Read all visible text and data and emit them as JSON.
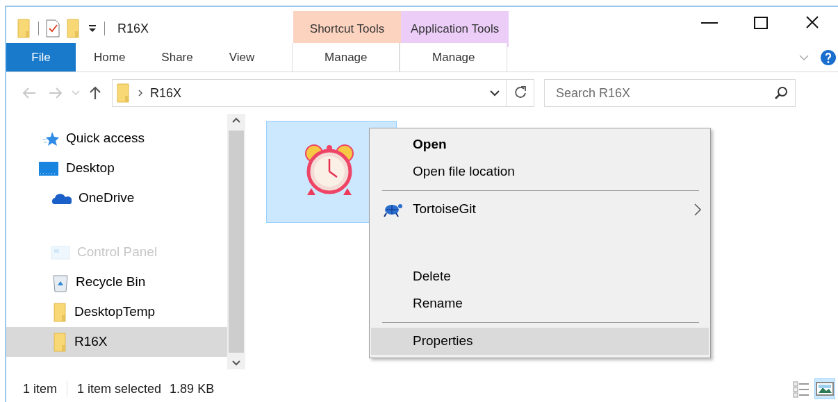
{
  "window": {
    "title": "R16X"
  },
  "context_tabs": [
    {
      "group": "Shortcut Tools",
      "label": "Manage",
      "color": "#fcd3bf"
    },
    {
      "group": "Application Tools",
      "label": "Manage",
      "color": "#ebcdf8"
    }
  ],
  "ribbon_tabs": [
    {
      "label": "File",
      "kind": "file"
    },
    {
      "label": "Home",
      "kind": "tab"
    },
    {
      "label": "Share",
      "kind": "tab"
    },
    {
      "label": "View",
      "kind": "tab"
    }
  ],
  "address": {
    "path": "R16X"
  },
  "search": {
    "placeholder": "Search R16X"
  },
  "sidebar": {
    "items": [
      {
        "label": "Quick access",
        "kind": "star",
        "selected": false,
        "dimmed": false
      },
      {
        "label": "Desktop",
        "kind": "desktop",
        "selected": false,
        "dimmed": false
      },
      {
        "label": "OneDrive",
        "kind": "cloud",
        "selected": false,
        "dimmed": false
      },
      {
        "label": "Control Panel",
        "kind": "panel",
        "selected": false,
        "dimmed": true
      },
      {
        "label": "Recycle Bin",
        "kind": "bin",
        "selected": false,
        "dimmed": false
      },
      {
        "label": "DesktopTemp",
        "kind": "folder",
        "selected": false,
        "dimmed": false
      },
      {
        "label": "R16X",
        "kind": "folder",
        "selected": true,
        "dimmed": false
      }
    ]
  },
  "file_item": {
    "selected": true
  },
  "context_menu": {
    "items": [
      {
        "label": "Open",
        "kind": "default",
        "selected": false
      },
      {
        "label": "Open file location",
        "kind": "plain",
        "selected": false
      },
      {
        "kind": "separator"
      },
      {
        "label": "TortoiseGit",
        "kind": "submenu",
        "selected": false
      },
      {
        "label": "Delete",
        "kind": "plain",
        "selected": false
      },
      {
        "label": "Rename",
        "kind": "plain",
        "selected": false
      },
      {
        "kind": "separator"
      },
      {
        "label": "Properties",
        "kind": "plain",
        "selected": true
      }
    ]
  },
  "status_bar": {
    "items": [
      "1 item",
      "1 item selected",
      "1.89 KB"
    ]
  },
  "view_buttons": [
    {
      "kind": "details",
      "selected": false
    },
    {
      "kind": "large-icons",
      "selected": true
    }
  ]
}
